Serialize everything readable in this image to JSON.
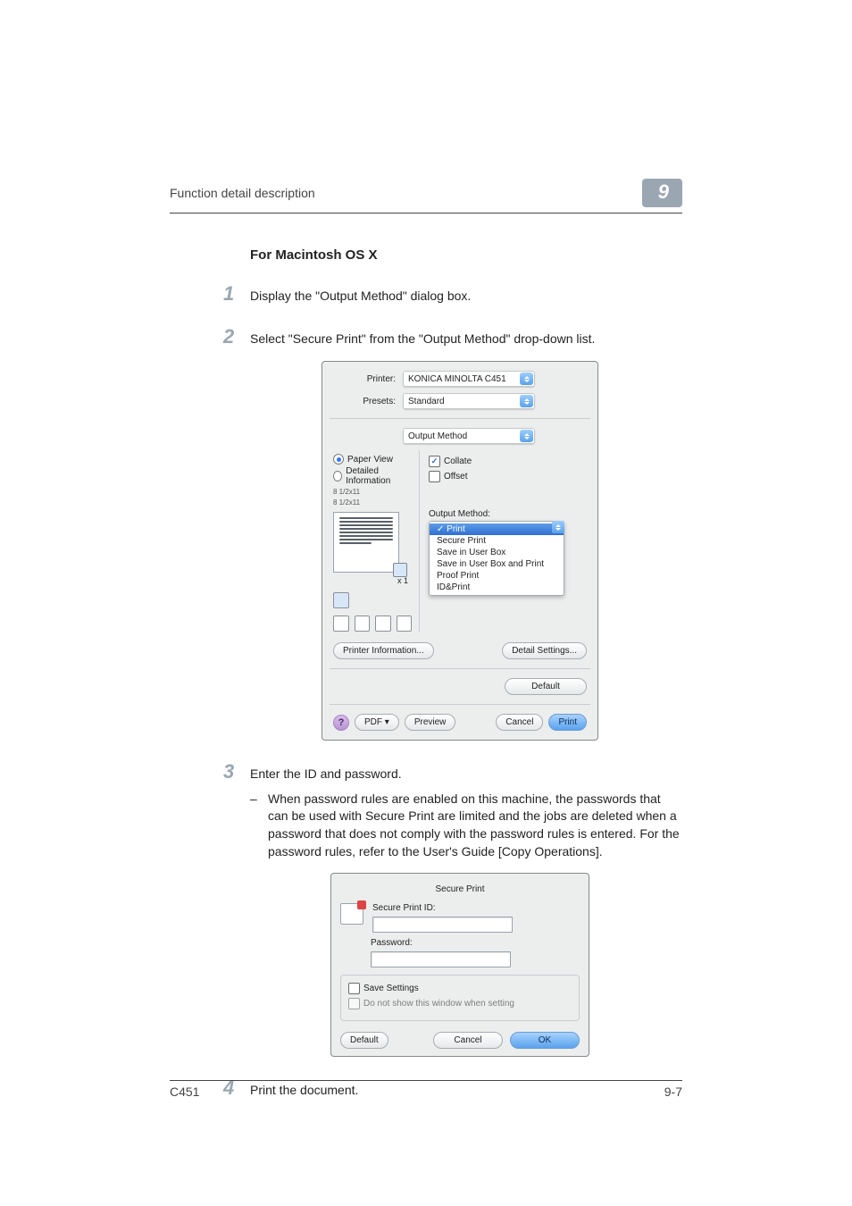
{
  "header": {
    "section": "Function detail description",
    "chapter": "9"
  },
  "section_title": "For Macintosh OS X",
  "steps": {
    "s1": {
      "num": "1",
      "text": "Display the \"Output Method\" dialog box."
    },
    "s2": {
      "num": "2",
      "text": "Select \"Secure Print\" from the \"Output Method\" drop-down list."
    },
    "s3": {
      "num": "3",
      "text": "Enter the ID and password.",
      "sub": "When password rules are enabled on this machine, the passwords that can be used with Secure Print are limited and the jobs are deleted when a password that does not comply with the password rules is entered. For the password rules, refer to the User's Guide [Copy Operations]."
    },
    "s4": {
      "num": "4",
      "text": "Print the document."
    }
  },
  "dialog1": {
    "printer_label": "Printer:",
    "printer_value": "KONICA MINOLTA C451",
    "presets_label": "Presets:",
    "presets_value": "Standard",
    "pane_value": "Output Method",
    "left": {
      "paper_view": "Paper View",
      "detailed": "Detailed Information",
      "dims": "8 1/2x11",
      "x1": "x 1",
      "printer_info": "Printer Information..."
    },
    "right": {
      "collate": "Collate",
      "offset": "Offset",
      "om_label": "Output Method:",
      "options": {
        "print": "Print",
        "secure": "Secure Print",
        "save_box": "Save in User Box",
        "save_box_print": "Save in User Box and Print",
        "proof": "Proof Print",
        "idprint": "ID&Print"
      },
      "detail_settings": "Detail Settings..."
    },
    "default_btn": "Default",
    "pdf_btn": "PDF ▾",
    "preview_btn": "Preview",
    "cancel_btn": "Cancel",
    "print_btn": "Print",
    "help": "?"
  },
  "dialog2": {
    "title": "Secure Print",
    "id_label": "Secure Print ID:",
    "pw_label": "Password:",
    "save_settings": "Save Settings",
    "no_show": "Do not show this window when setting",
    "default_btn": "Default",
    "cancel_btn": "Cancel",
    "ok_btn": "OK"
  },
  "footer": {
    "model": "C451",
    "page": "9-7"
  }
}
